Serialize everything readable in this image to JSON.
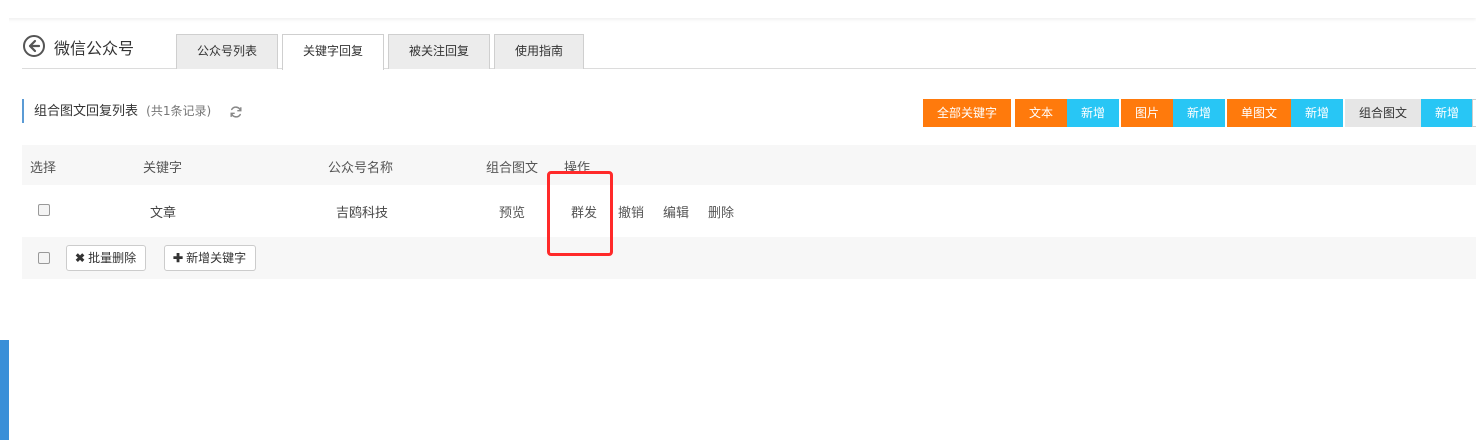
{
  "header": {
    "title": "微信公众号",
    "tabs": [
      {
        "label": "公众号列表"
      },
      {
        "label": "关键字回复"
      },
      {
        "label": "被关注回复"
      },
      {
        "label": "使用指南"
      }
    ]
  },
  "list": {
    "title": "组合图文回复列表",
    "count": "(共1条记录)"
  },
  "toolbar": {
    "all_keywords": "全部关键字",
    "text": "文本",
    "image": "图片",
    "single_news": "单图文",
    "multi_news": "组合图文",
    "add": "新增"
  },
  "table": {
    "columns": [
      "选择",
      "关键字",
      "公众号名称",
      "组合图文",
      "操作"
    ],
    "rows": [
      {
        "keyword": "文章",
        "account": "吉鸥科技",
        "preview": "预览",
        "actions": [
          "群发",
          "撤销",
          "编辑",
          "删除"
        ]
      }
    ],
    "footer": {
      "batch_delete": "批量删除",
      "add_keyword": "新增关键字"
    }
  },
  "colors": {
    "orange": "#ff7a0c",
    "cyan": "#28c6f5",
    "highlight": "#ff2a2a"
  }
}
